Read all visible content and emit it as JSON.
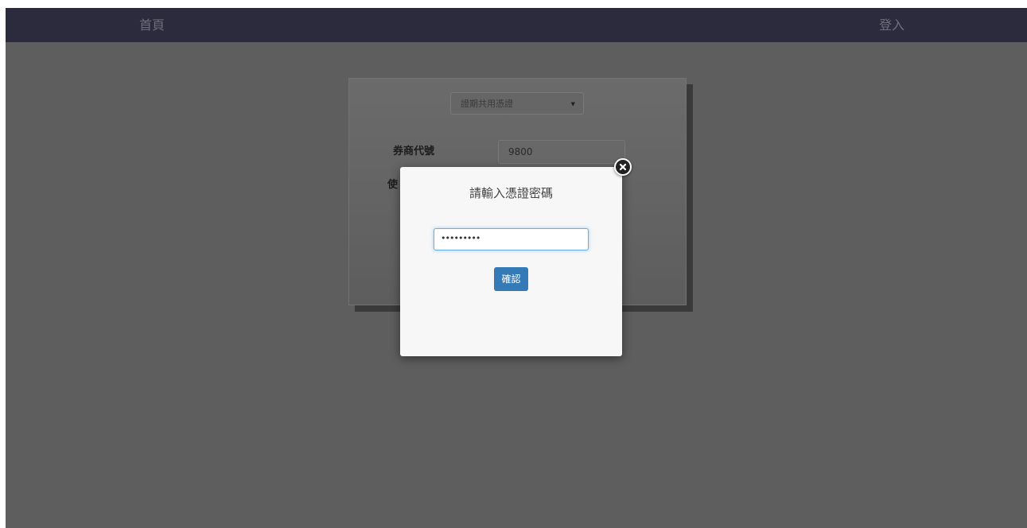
{
  "navbar": {
    "home_label": "首頁",
    "login_label": "登入"
  },
  "login_form": {
    "cert_select": {
      "selected": "證期共用憑證"
    },
    "broker_code_label": "券商代號",
    "broker_code_value": "9800",
    "user_label_visible": "使"
  },
  "modal": {
    "title": "請輸入憑證密碼",
    "password_value": "•••••••••",
    "confirm_label": "確認",
    "close_icon": "close-icon"
  },
  "colors": {
    "navbar_bg": "#2b2b3d",
    "overlay_bg": "#5e5e5e",
    "modal_bg": "#f7f7f7",
    "primary_button": "#337ab7",
    "input_focus": "#66afe9"
  }
}
